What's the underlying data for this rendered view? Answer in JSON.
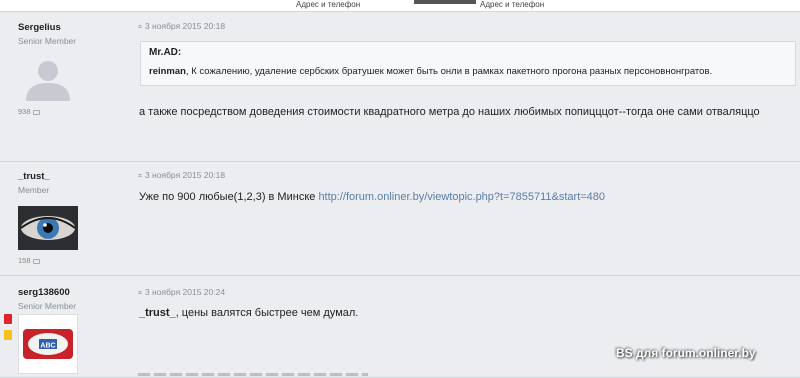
{
  "top": {
    "caption_left": "Адрес и телефон",
    "caption_right": "Адрес и телефон"
  },
  "posts": [
    {
      "author": "Sergelius",
      "rank": "Senior Member",
      "count": "938",
      "date": "3 ноября 2015 20:18",
      "quote_author": "Mr.AD:",
      "quote_user": "reinman",
      "quote_rest": ", К сожалению, удаление сербских братушек может быть онли в рамках пакетного прогона разных персоновнонгратов.",
      "message": "а также посредством доведения стоимости квадратного метра до наших любимых попицццот--тогда оне сами отваляццо"
    },
    {
      "author": "_trust_",
      "rank": "Member",
      "count": "158",
      "date": "3 ноября 2015 20:18",
      "message_text": "Уже по 900 любые(1,2,3) в Минске ",
      "link": "http://forum.onliner.by/viewtopic.php?t=7855711&start=480"
    },
    {
      "author": "serg138600",
      "rank": "Senior Member",
      "date": "3 ноября 2015 20:24",
      "mention": "_trust_",
      "message_rest": ", цены валятся быстрее чем думал.",
      "avatar_label": "ABC"
    }
  ],
  "watermark": "BS для forum.onliner.by",
  "colors": {
    "background": "#ebedf0",
    "link": "#5a7fa8",
    "flag_red": "#e0232b",
    "flag_yellow": "#f5c21b"
  }
}
